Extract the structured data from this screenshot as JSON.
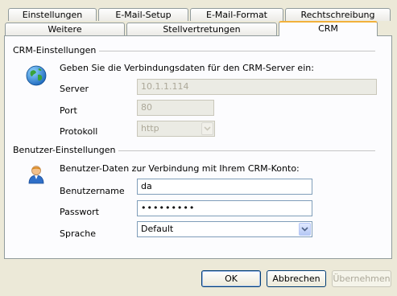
{
  "tabs_row1": [
    "Einstellungen",
    "E-Mail-Setup",
    "E-Mail-Format",
    "Rechtschreibung"
  ],
  "tabs_row2": [
    "Weitere",
    "Stellvertretungen",
    "CRM"
  ],
  "crm": {
    "group_title": "CRM-Einstellungen",
    "description": "Geben Sie die Verbindungsdaten für den CRM-Server ein:",
    "server_label": "Server",
    "server_value": "10.1.1.114",
    "port_label": "Port",
    "port_value": "80",
    "protocol_label": "Protokoll",
    "protocol_value": "http",
    "icon": "globe-icon"
  },
  "user": {
    "group_title": "Benutzer-Einstellungen",
    "description": "Benutzer-Daten zur Verbindung mit Ihrem CRM-Konto:",
    "username_label": "Benutzername",
    "username_value": "da",
    "password_label": "Passwort",
    "password_value": "•••••••••",
    "language_label": "Sprache",
    "language_value": "Default",
    "icon": "user-icon"
  },
  "buttons": {
    "ok": "OK",
    "cancel": "Abbrechen",
    "apply": "Übernehmen"
  },
  "colors": {
    "background": "#ece9d8",
    "active_tab_accent": "#f2b13b",
    "field_border": "#7f9db9"
  }
}
